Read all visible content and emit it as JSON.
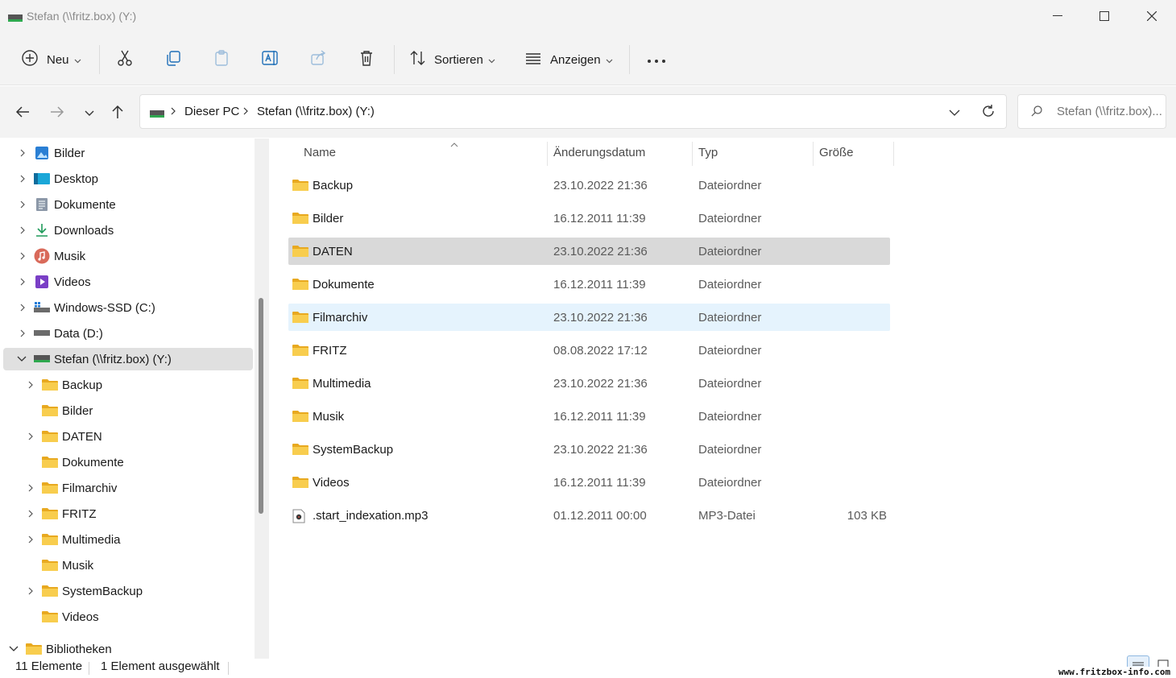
{
  "window": {
    "title": "Stefan (\\\\fritz.box) (Y:)"
  },
  "commandbar": {
    "new_label": "Neu",
    "sort_label": "Sortieren",
    "view_label": "Anzeigen",
    "more_label": "···"
  },
  "address": {
    "crumbs": [
      "Dieser PC",
      "Stefan (\\\\fritz.box) (Y:)"
    ],
    "search_placeholder": "Stefan (\\\\fritz.box)..."
  },
  "sidebar": {
    "items": [
      {
        "label": "Bilder",
        "icon": "pictures-icon"
      },
      {
        "label": "Desktop",
        "icon": "desktop-icon"
      },
      {
        "label": "Dokumente",
        "icon": "documents-icon"
      },
      {
        "label": "Downloads",
        "icon": "downloads-icon"
      },
      {
        "label": "Musik",
        "icon": "music-icon"
      },
      {
        "label": "Videos",
        "icon": "videos-icon"
      },
      {
        "label": "Windows-SSD (C:)",
        "icon": "windows-drive-icon"
      },
      {
        "label": "Data (D:)",
        "icon": "drive-icon"
      },
      {
        "label": "Stefan (\\\\fritz.box) (Y:)",
        "icon": "network-drive-icon"
      },
      {
        "label": "Backup",
        "icon": "folder-icon"
      },
      {
        "label": "Bilder",
        "icon": "folder-icon"
      },
      {
        "label": "DATEN",
        "icon": "folder-icon"
      },
      {
        "label": "Dokumente",
        "icon": "folder-icon"
      },
      {
        "label": "Filmarchiv",
        "icon": "folder-icon"
      },
      {
        "label": "FRITZ",
        "icon": "folder-icon"
      },
      {
        "label": "Multimedia",
        "icon": "folder-icon"
      },
      {
        "label": "Musik",
        "icon": "folder-icon"
      },
      {
        "label": "SystemBackup",
        "icon": "folder-icon"
      },
      {
        "label": "Videos",
        "icon": "folder-icon"
      },
      {
        "label": "Bibliotheken",
        "icon": "folder-icon"
      }
    ]
  },
  "columns": {
    "name": "Name",
    "date": "Änderungsdatum",
    "type": "Typ",
    "size": "Größe"
  },
  "files": [
    {
      "name": "Backup",
      "date": "23.10.2022 21:36",
      "type": "Dateiordner",
      "size": ""
    },
    {
      "name": "Bilder",
      "date": "16.12.2011 11:39",
      "type": "Dateiordner",
      "size": ""
    },
    {
      "name": "DATEN",
      "date": "23.10.2022 21:36",
      "type": "Dateiordner",
      "size": ""
    },
    {
      "name": "Dokumente",
      "date": "16.12.2011 11:39",
      "type": "Dateiordner",
      "size": ""
    },
    {
      "name": "Filmarchiv",
      "date": "23.10.2022 21:36",
      "type": "Dateiordner",
      "size": ""
    },
    {
      "name": "FRITZ",
      "date": "08.08.2022 17:12",
      "type": "Dateiordner",
      "size": ""
    },
    {
      "name": "Multimedia",
      "date": "23.10.2022 21:36",
      "type": "Dateiordner",
      "size": ""
    },
    {
      "name": "Musik",
      "date": "16.12.2011 11:39",
      "type": "Dateiordner",
      "size": ""
    },
    {
      "name": "SystemBackup",
      "date": "23.10.2022 21:36",
      "type": "Dateiordner",
      "size": ""
    },
    {
      "name": "Videos",
      "date": "16.12.2011 11:39",
      "type": "Dateiordner",
      "size": ""
    },
    {
      "name": ".start_indexation.mp3",
      "date": "01.12.2011 00:00",
      "type": "MP3-Datei",
      "size": "103 KB"
    }
  ],
  "status": {
    "count": "11 Elemente",
    "selection": "1 Element ausgewählt"
  },
  "watermark": "www.fritzbox-info.com",
  "colors": {
    "folder": "#f5c33b",
    "selected_row": "#d9d9d9",
    "hover_row": "#e5f3fd",
    "chrome": "#f3f3f3"
  }
}
